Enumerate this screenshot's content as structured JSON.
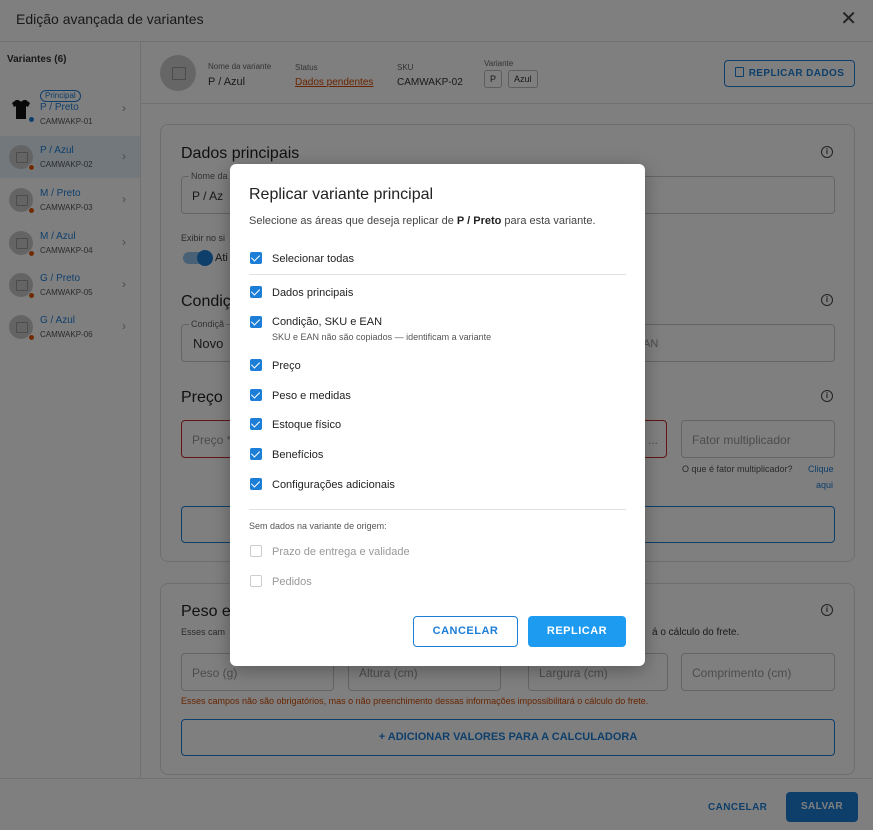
{
  "window": {
    "title": "Edição avançada de variantes",
    "close_icon": "close-icon"
  },
  "sidebar": {
    "heading": "Variantes (6)",
    "items": [
      {
        "badge": "Principal",
        "label": "P / Preto",
        "sku": "CAMWAKP-01"
      },
      {
        "label": "P / Azul",
        "sku": "CAMWAKP-02"
      },
      {
        "label": "M / Preto",
        "sku": "CAMWAKP-03"
      },
      {
        "label": "M / Azul",
        "sku": "CAMWAKP-04"
      },
      {
        "label": "G / Preto",
        "sku": "CAMWAKP-05"
      },
      {
        "label": "G / Azul",
        "sku": "CAMWAKP-06"
      }
    ]
  },
  "variant_header": {
    "name_label": "Nome da variante",
    "name_value": "P / Azul",
    "status_label": "Status",
    "status_value": "Dados pendentes",
    "sku_label": "SKU",
    "sku_value": "CAMWAKP-02",
    "variant_label": "Variante",
    "chips": [
      "P",
      "Azul"
    ],
    "replicate_button": "REPLICAR DADOS"
  },
  "form": {
    "main_title": "Dados principais",
    "name_field_label": "Nome da",
    "name_field_value": "P / Az",
    "show_label": "Exibir no si",
    "active_label": "Ati",
    "condition_title": "Condiç",
    "condition_field_label": "Condiçã",
    "condition_value": "Novo",
    "ean_placeholder": "AN",
    "price_title": "Preço",
    "price_placeholder": "Preço *",
    "price_dots": "...",
    "multiplier_placeholder": "Fator multiplicador",
    "multiplier_help": "O que é fator multiplicador?",
    "multiplier_link_1": "Clique",
    "multiplier_link_2": "aqui",
    "weight_title": "Peso e",
    "weight_sub_left": "Esses cam",
    "weight_sub_right": "á o cálculo do frete.",
    "weight_placeholder": "Peso (g)",
    "height_placeholder": "Altura (cm)",
    "width_placeholder": "Largura (cm)",
    "length_placeholder": "Comprimento (cm)",
    "weight_warning": "Esses campos não são obrigatórios, mas o não preenchimento dessas informações impossibilitará o cálculo do frete.",
    "calculator_button": "+ ADICIONAR VALORES PARA A CALCULADORA"
  },
  "footer": {
    "cancel": "CANCELAR",
    "save": "SALVAR"
  },
  "modal": {
    "title": "Replicar variante principal",
    "subtitle_prefix": "Selecione as áreas que deseja replicar de ",
    "subtitle_bold": "P / Preto",
    "subtitle_suffix": " para esta variante.",
    "select_all": "Selecionar todas",
    "options": [
      {
        "label": "Dados principais",
        "checked": true
      },
      {
        "label": "Condição, SKU e EAN",
        "hint": "SKU e EAN não são copiados — identificam a variante",
        "checked": true
      },
      {
        "label": "Preço",
        "checked": true
      },
      {
        "label": "Peso e medidas",
        "checked": true
      },
      {
        "label": "Estoque físico",
        "checked": true
      },
      {
        "label": "Benefícios",
        "checked": true
      },
      {
        "label": "Configurações adicionais",
        "checked": true
      }
    ],
    "no_data_note": "Sem dados na variante de origem:",
    "disabled_options": [
      {
        "label": "Prazo de entrega e validade",
        "checked": false
      },
      {
        "label": "Pedidos",
        "checked": false
      }
    ],
    "cancel": "CANCELAR",
    "confirm": "REPLICAR"
  }
}
